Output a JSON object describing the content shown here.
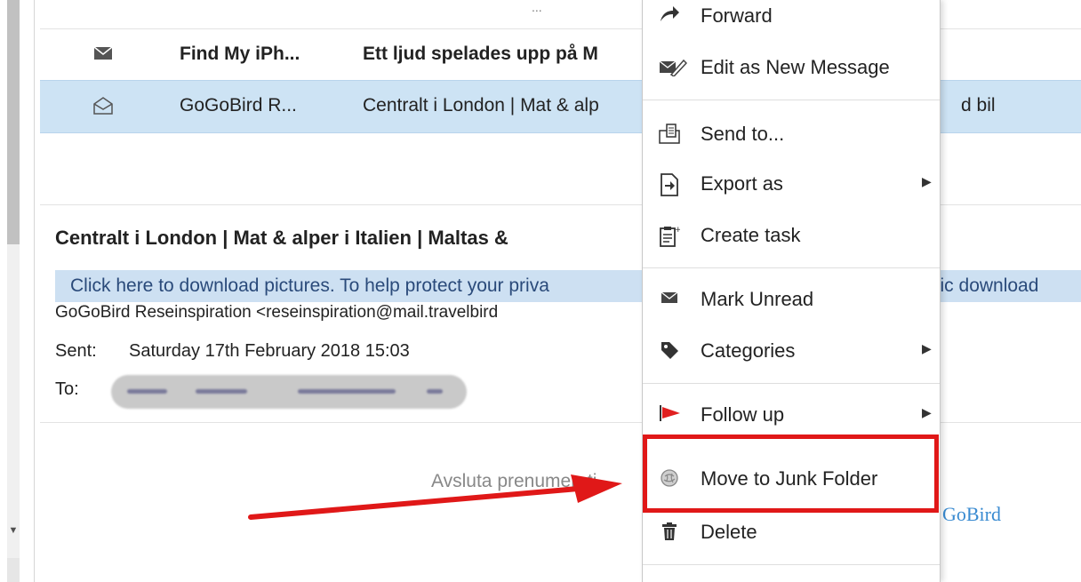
{
  "message_list": {
    "top_partial_text": "...",
    "rows": [
      {
        "from": "Find My iPh...",
        "subject": "Ett ljud spelades upp på M",
        "unread": true,
        "icon": "envelope-closed-icon"
      },
      {
        "from": "GoGoBird R...",
        "subject": "Centralt i London | Mat & alp",
        "trailing_subject": "d bil",
        "unread": false,
        "selected": true,
        "icon": "envelope-open-icon"
      }
    ]
  },
  "reading_pane": {
    "subject": "Centralt i London | Mat & alper i Italien | Maltas &",
    "infobar_left": "Click here to download pictures. To help protect your priva",
    "infobar_right": "atic download",
    "sender": "GoGoBird Reseinspiration <reseinspiration@mail.travelbird",
    "sent_label": "Sent:",
    "sent_value": "Saturday 17th February 2018 15:03",
    "to_label": "To:",
    "body_unsubscribe": "Avsluta prenumerati",
    "body_brand": "GoBird"
  },
  "context_menu": {
    "items": [
      {
        "label": "Forward",
        "icon": "forward-arrow-icon"
      },
      {
        "label": "Edit as New Message",
        "icon": "edit-message-icon"
      },
      {
        "label": "Send to...",
        "icon": "send-to-icon"
      },
      {
        "label": "Export as",
        "icon": "export-icon",
        "submenu": true
      },
      {
        "label": "Create task",
        "icon": "create-task-icon"
      },
      {
        "label": "Mark Unread",
        "icon": "envelope-icon"
      },
      {
        "label": "Categories",
        "icon": "tag-icon",
        "submenu": true
      },
      {
        "label": "Follow up",
        "icon": "flag-icon",
        "submenu": true
      },
      {
        "label": "Move to Junk Folder",
        "icon": "junk-icon",
        "highlighted": true
      },
      {
        "label": "Delete",
        "icon": "trash-icon"
      }
    ]
  },
  "colors": {
    "selection_row": "#cde3f4",
    "infobar": "#cde0f2",
    "highlight_box": "#e01818",
    "flag": "#e02020"
  }
}
